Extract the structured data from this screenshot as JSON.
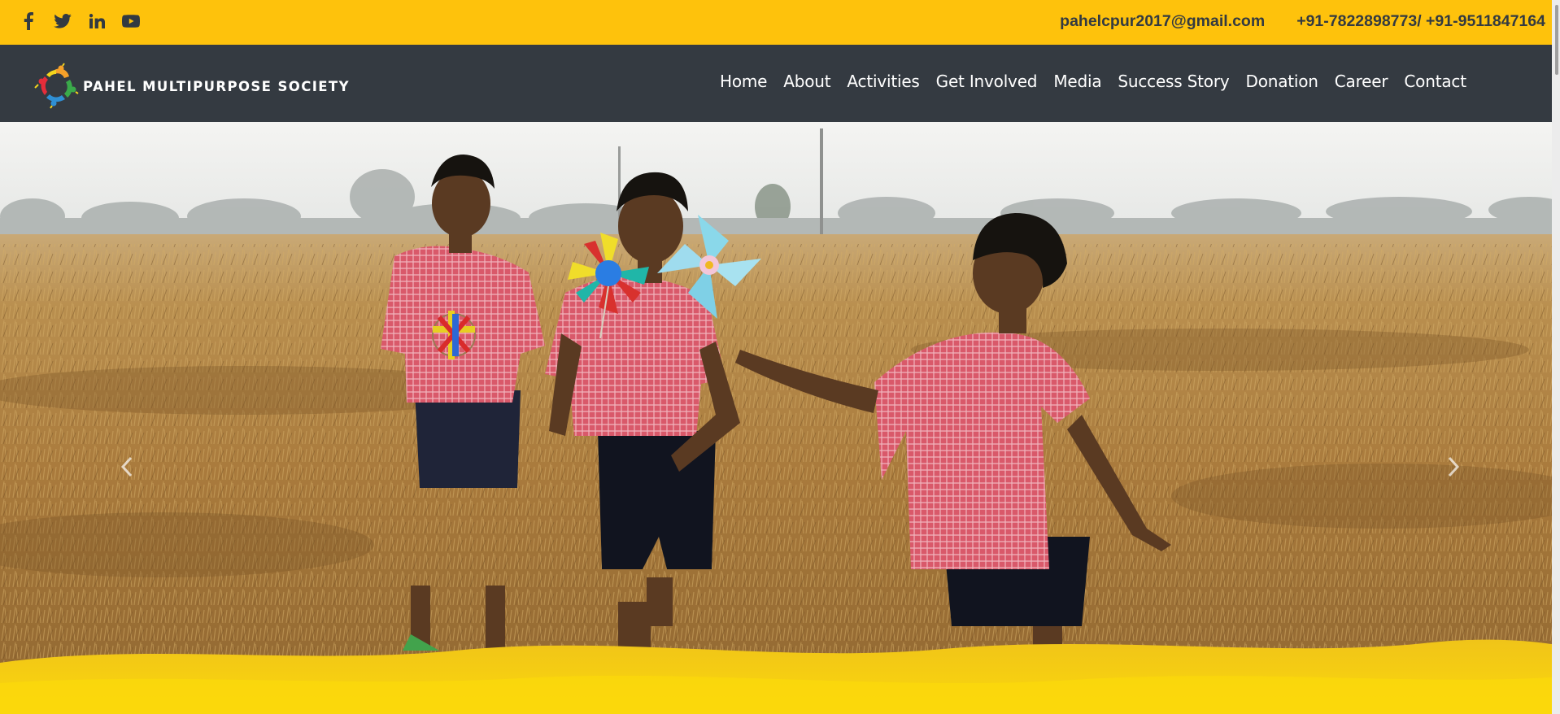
{
  "topbar": {
    "social": [
      {
        "icon": "facebook-icon"
      },
      {
        "icon": "twitter-icon"
      },
      {
        "icon": "linkedin-icon"
      },
      {
        "icon": "youtube-icon"
      }
    ],
    "email": "pahelcpur2017@gmail.com",
    "phone": "+91-7822898773/ +91-9511847164"
  },
  "brand": {
    "name": "PAHEL MULTIPURPOSE SOCIETY",
    "logo_icon": "colorful-hands-circle-logo"
  },
  "nav": {
    "items": [
      {
        "label": "Home"
      },
      {
        "label": "About"
      },
      {
        "label": "Activities"
      },
      {
        "label": "Get Involved"
      },
      {
        "label": "Media"
      },
      {
        "label": "Success Story"
      },
      {
        "label": "Donation"
      },
      {
        "label": "Career"
      },
      {
        "label": "Contact"
      }
    ]
  },
  "hero": {
    "image": "three children in red checked shirts running through harvested field with pinwheels",
    "prev_icon": "chevron-left-icon",
    "next_icon": "chevron-right-icon"
  },
  "colors": {
    "topbar": "#fec20c",
    "navbar": "#343a41",
    "nav_text": "#ffffff",
    "contact_text": "#333a41",
    "hero_bottom_wave": "#f9cb0f"
  }
}
